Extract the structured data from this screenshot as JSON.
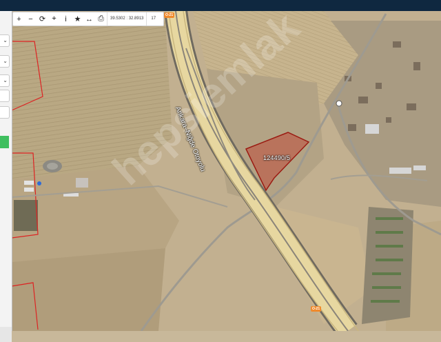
{
  "map": {
    "coordinates": "39.5302 : 32.8913",
    "zoom_level": "17",
    "parcel_label": "124490/5",
    "road_name": "Ankara–Niğde Otoyolu",
    "highway_shield": "O-21",
    "watermark": "hepsiemlak",
    "parcel_color": "#c0392b"
  },
  "toolbar": {
    "tools": [
      {
        "name": "zoom-in",
        "glyph": "+"
      },
      {
        "name": "zoom-out",
        "glyph": "−"
      },
      {
        "name": "refresh",
        "glyph": "⟳"
      },
      {
        "name": "locate",
        "glyph": "⌖"
      },
      {
        "name": "info",
        "glyph": "i"
      },
      {
        "name": "favorite",
        "glyph": "★"
      },
      {
        "name": "measure",
        "glyph": "↔"
      },
      {
        "name": "print",
        "glyph": "⎙"
      }
    ]
  }
}
